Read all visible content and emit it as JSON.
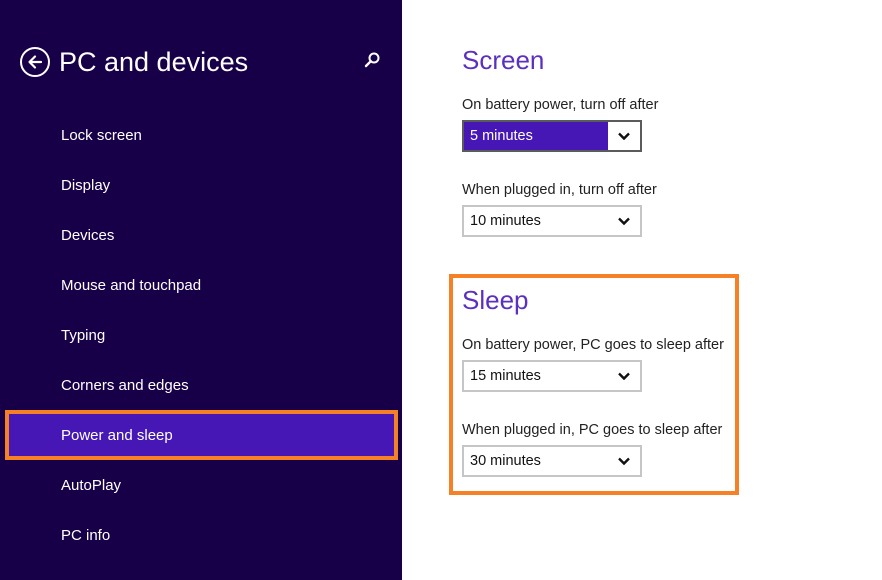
{
  "sidebar": {
    "title": "PC and devices",
    "back_icon": "back-arrow-circle-icon",
    "search_icon": "search-icon",
    "items": [
      {
        "label": "Lock screen",
        "selected": false
      },
      {
        "label": "Display",
        "selected": false
      },
      {
        "label": "Devices",
        "selected": false
      },
      {
        "label": "Mouse and touchpad",
        "selected": false
      },
      {
        "label": "Typing",
        "selected": false
      },
      {
        "label": "Corners and edges",
        "selected": false
      },
      {
        "label": "Power and sleep",
        "selected": true
      },
      {
        "label": "AutoPlay",
        "selected": false
      },
      {
        "label": "PC info",
        "selected": false
      }
    ]
  },
  "screen": {
    "title": "Screen",
    "battery_label": "On battery power, turn off after",
    "battery_value": "5 minutes",
    "plugged_label": "When plugged in, turn off after",
    "plugged_value": "10 minutes"
  },
  "sleep": {
    "title": "Sleep",
    "battery_label": "On battery power, PC goes to sleep after",
    "battery_value": "15 minutes",
    "plugged_label": "When plugged in, PC goes to sleep after",
    "plugged_value": "30 minutes"
  },
  "colors": {
    "sidebar_bg": "#180048",
    "selected_bg": "#4617b4",
    "accent_text": "#5b2fc0",
    "highlight": "#f58025"
  }
}
